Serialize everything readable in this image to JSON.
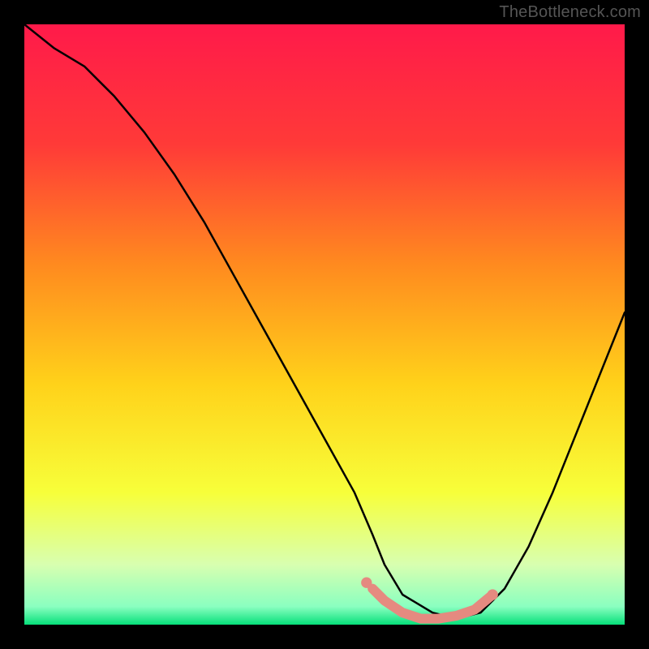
{
  "watermark": "TheBottleneck.com",
  "chart_data": {
    "type": "line",
    "title": "",
    "xlabel": "",
    "ylabel": "",
    "xlim": [
      0,
      100
    ],
    "ylim": [
      0,
      100
    ],
    "background_gradient": {
      "stops": [
        {
          "offset": 0.0,
          "color": "#ff1a4a"
        },
        {
          "offset": 0.2,
          "color": "#ff3a38"
        },
        {
          "offset": 0.4,
          "color": "#ff8a1f"
        },
        {
          "offset": 0.6,
          "color": "#ffd21a"
        },
        {
          "offset": 0.78,
          "color": "#f7ff3a"
        },
        {
          "offset": 0.9,
          "color": "#d8ffb0"
        },
        {
          "offset": 0.97,
          "color": "#8affc0"
        },
        {
          "offset": 1.0,
          "color": "#06e07a"
        }
      ]
    },
    "series": [
      {
        "name": "bottleneck-curve",
        "color": "#000000",
        "x": [
          0,
          5,
          10,
          15,
          20,
          25,
          30,
          35,
          40,
          45,
          50,
          55,
          58,
          60,
          63,
          68,
          72,
          76,
          80,
          84,
          88,
          92,
          96,
          100
        ],
        "values": [
          100,
          96,
          93,
          88,
          82,
          75,
          67,
          58,
          49,
          40,
          31,
          22,
          15,
          10,
          5,
          2,
          1,
          2,
          6,
          13,
          22,
          32,
          42,
          52
        ]
      },
      {
        "name": "optimal-region-highlight",
        "color": "#e58a80",
        "x": [
          58,
          60,
          63,
          66,
          69,
          72,
          75,
          78
        ],
        "values": [
          6,
          4,
          2,
          1,
          1,
          1.5,
          2.5,
          5
        ]
      }
    ],
    "markers": [
      {
        "name": "left-marker-dot",
        "x": 57,
        "y": 7,
        "color": "#e58a80"
      },
      {
        "name": "right-marker-dot",
        "x": 78,
        "y": 5,
        "color": "#e58a80"
      }
    ]
  }
}
